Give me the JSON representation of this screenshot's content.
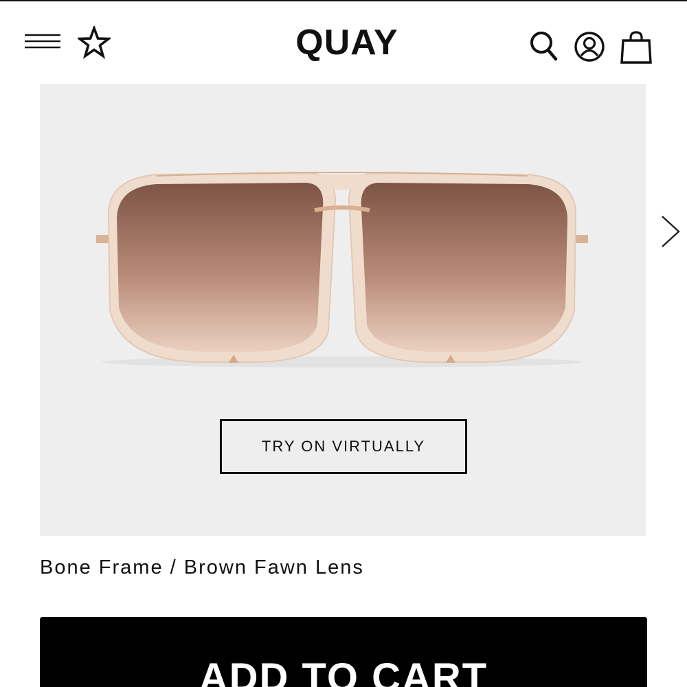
{
  "header": {
    "logo": "QUAY",
    "icons": [
      "menu-icon",
      "star-icon",
      "search-icon",
      "account-icon",
      "shopping-bag-icon"
    ]
  },
  "gallery": {
    "try_on_label": "TRY ON VIRTUALLY",
    "next_icon": "chevron-right-icon",
    "background": "#eeeeef"
  },
  "product": {
    "variant": "Bone Frame / Brown Fawn Lens",
    "frame_color": "#efdccd",
    "lens_top_color": "#7d5446",
    "lens_bottom_color": "#ead0c0"
  },
  "actions": {
    "add_to_cart_label": "ADD TO CART"
  },
  "colors": {
    "primary": "#000000",
    "text": "#111111"
  }
}
